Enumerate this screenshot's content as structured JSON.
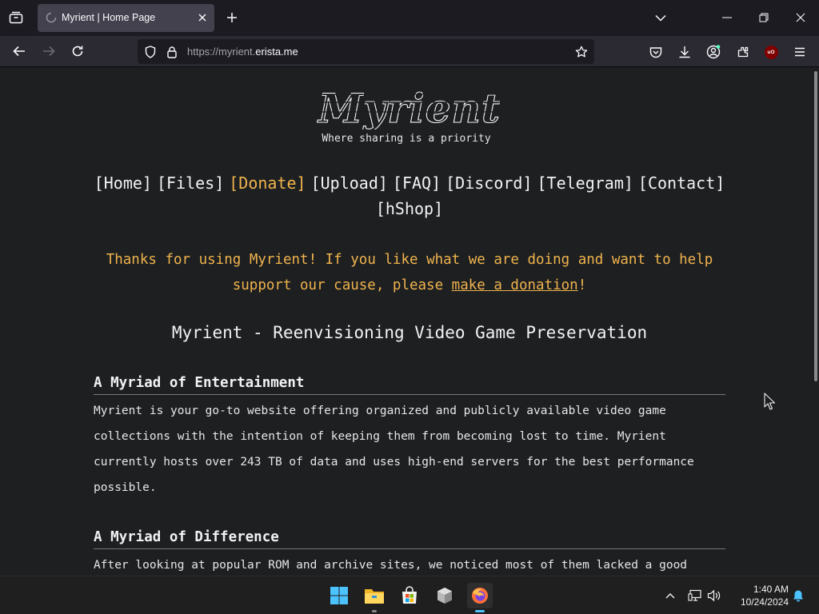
{
  "browser": {
    "tab_title": "Myrient | Home Page",
    "url_protocol": "https://",
    "url_sub": "myrient.",
    "url_domain": "erista.me",
    "ublock_label": "uO"
  },
  "page": {
    "logo_text": "Myrient",
    "tagline": "Where sharing is a priority",
    "menu": [
      "[Home]",
      "[Files]",
      "[Donate]",
      "[Upload]",
      "[FAQ]",
      "[Discord]",
      "[Telegram]",
      "[Contact]",
      "[hShop]"
    ],
    "thanks_pre": "Thanks for using Myrient! If you like what we are doing and want to help support our cause, please ",
    "thanks_link": "make a donation",
    "thanks_post": "!",
    "main_heading": "Myrient - Reenvisioning Video Game Preservation",
    "sections": [
      {
        "heading": "A Myriad of Entertainment",
        "body": "Myrient is your go-to website offering organized and publicly available video game collections with the intention of keeping them from becoming lost to time. Myrient currently hosts over 243 TB of data and uses high-end servers for the best performance possible."
      },
      {
        "heading": "A Myriad of Difference",
        "body": "After looking at popular ROM and archive sites, we noticed most of them lacked a good"
      }
    ]
  },
  "taskbar": {
    "time": "1:40 AM",
    "date": "10/24/2024"
  },
  "colors": {
    "accent": "#f0b34d",
    "page_bg": "#1d1f21",
    "chrome_bg": "#2b2a33"
  }
}
